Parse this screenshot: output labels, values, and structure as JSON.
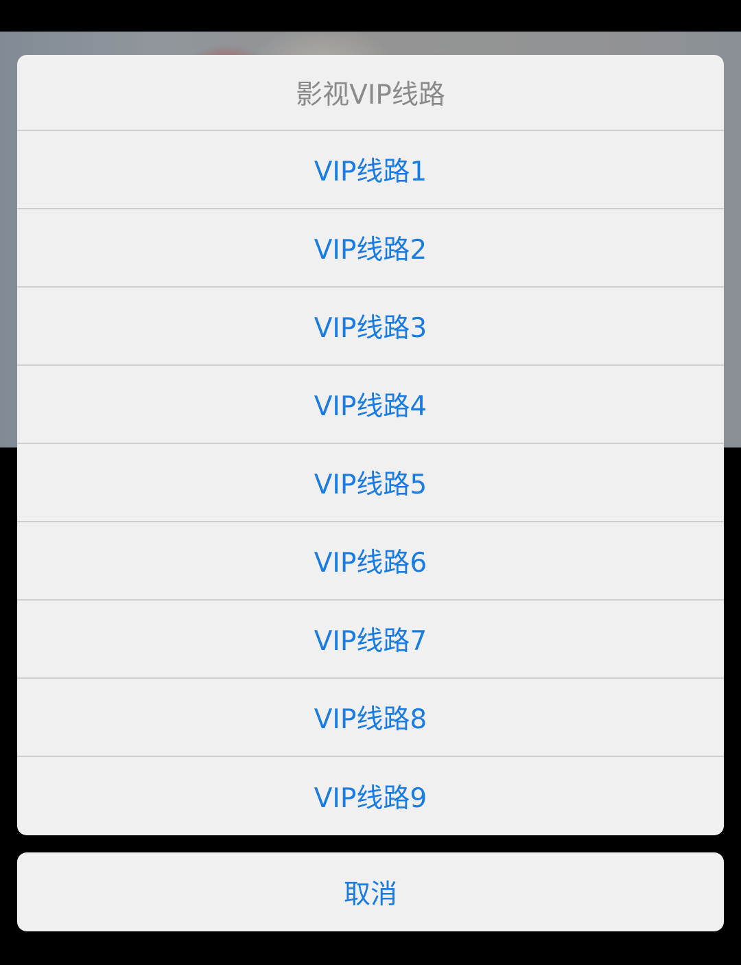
{
  "sheet": {
    "title": "影视VIP线路",
    "options": [
      {
        "label": "VIP线路1"
      },
      {
        "label": "VIP线路2"
      },
      {
        "label": "VIP线路3"
      },
      {
        "label": "VIP线路4"
      },
      {
        "label": "VIP线路5"
      },
      {
        "label": "VIP线路6"
      },
      {
        "label": "VIP线路7"
      },
      {
        "label": "VIP线路8"
      },
      {
        "label": "VIP线路9"
      }
    ],
    "cancel_label": "取消"
  },
  "colors": {
    "accent": "#1a7be0",
    "title_text": "#8a8a8a",
    "sheet_background": "#f0f0f0",
    "divider": "#d0d0d0",
    "screen_background": "#000000"
  }
}
